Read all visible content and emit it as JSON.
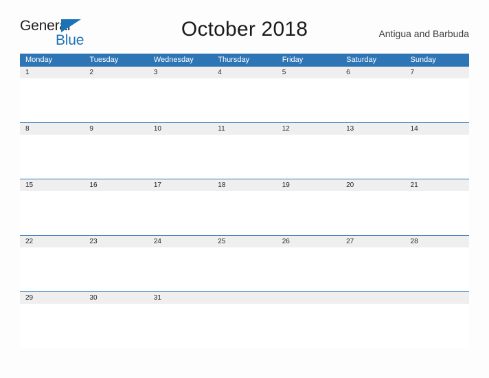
{
  "brand": {
    "name_part1": "General",
    "name_part2": "Blue",
    "triangle_icon": "triangle-icon",
    "color_dark": "#231f20",
    "color_blue": "#2072b8"
  },
  "header": {
    "title": "October 2018",
    "location": "Antigua and Barbuda"
  },
  "theme": {
    "header_blue": "#2e75b6",
    "date_band_gray": "#efefef",
    "page_background": "#fdfdfd",
    "text_dark": "#262626"
  },
  "calendar": {
    "weekdays": [
      "Monday",
      "Tuesday",
      "Wednesday",
      "Thursday",
      "Friday",
      "Saturday",
      "Sunday"
    ],
    "weeks": [
      [
        "1",
        "2",
        "3",
        "4",
        "5",
        "6",
        "7"
      ],
      [
        "8",
        "9",
        "10",
        "11",
        "12",
        "13",
        "14"
      ],
      [
        "15",
        "16",
        "17",
        "18",
        "19",
        "20",
        "21"
      ],
      [
        "22",
        "23",
        "24",
        "25",
        "26",
        "27",
        "28"
      ],
      [
        "29",
        "30",
        "31",
        "",
        "",
        "",
        ""
      ]
    ]
  }
}
